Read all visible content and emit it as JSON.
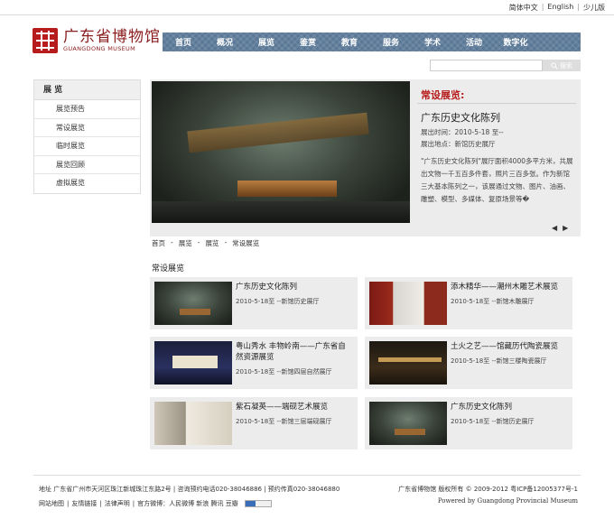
{
  "top_links": {
    "simplified": "简体中文",
    "english": "English",
    "kids": "少儿版"
  },
  "logo": {
    "cn": "广东省博物馆",
    "en": "GUANGDONG MUSEUM"
  },
  "nav": [
    "首页",
    "概况",
    "展览",
    "鉴赏",
    "教育",
    "服务",
    "学术",
    "活动",
    "数字化"
  ],
  "search": {
    "placeholder": "",
    "button": "搜索"
  },
  "sidebar": {
    "heading": "展 览",
    "items": [
      "展览预告",
      "常设展览",
      "临时展览",
      "展览回顾",
      "虚拟展览"
    ]
  },
  "feature": {
    "label": "常设展览:",
    "title": "广东历史文化陈列",
    "time": "展出时间：2010-5-18 至--",
    "place": "展出地点：新馆历史展厅",
    "desc": "\"广东历史文化陈列\"展厅面积4000多平方米，共展出文物一千五百多件套，照片三百多张。作为新馆三大基本陈列之一，该展通过文物、图片、油画、雕塑、模型、多媒体、复原场景等�",
    "prev": "◀",
    "next": "▶"
  },
  "breadcrumb": [
    "首页",
    "展览",
    "展览",
    "常设展览"
  ],
  "section_title": "常设展览",
  "cards": [
    {
      "name": "广东历史文化陈列",
      "meta": "2010-5-18至 --新馆历史展厅"
    },
    {
      "name": "添木精华——潮州木雕艺术展览",
      "meta": "2010-5-18至 --新馆木雕展厅"
    },
    {
      "name": "粤山秀水 丰物岭南——广东省自然资源展览",
      "meta": "2010-5-18至 --新馆四层自然展厅"
    },
    {
      "name": "土火之艺——馆藏历代陶瓷展览",
      "meta": "2010-5-18至 --新馆三楼陶瓷展厅"
    },
    {
      "name": "紫石凝英——端砚艺术展览",
      "meta": "2010-5-18至 --新馆三层端砚展厅"
    },
    {
      "name": "广东历史文化陈列",
      "meta": "2010-5-18至 --新馆历史展厅"
    }
  ],
  "footer": {
    "address": "地址 广东省广州市天河区珠江新城珠江东路2号 | 咨询预约电话020-38046886 | 预约传真020-38046880",
    "links": [
      "网站地图",
      "友情链接",
      "法律声明",
      "官方微博：人民微博 新浪 腾讯 豆瓣"
    ],
    "copyright": "广东省博物馆 版权所有 © 2009-2012 粤ICP备12005377号-1",
    "powered": "Powered by Guangdong Provincial Museum"
  }
}
